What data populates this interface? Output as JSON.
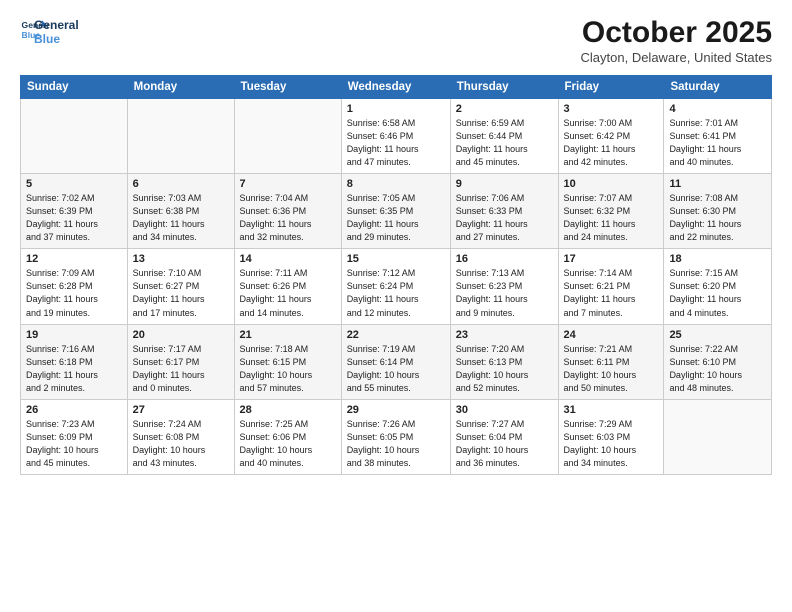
{
  "logo": {
    "line1": "General",
    "line2": "Blue"
  },
  "title": "October 2025",
  "location": "Clayton, Delaware, United States",
  "headers": [
    "Sunday",
    "Monday",
    "Tuesday",
    "Wednesday",
    "Thursday",
    "Friday",
    "Saturday"
  ],
  "weeks": [
    [
      {
        "day": "",
        "info": ""
      },
      {
        "day": "",
        "info": ""
      },
      {
        "day": "",
        "info": ""
      },
      {
        "day": "1",
        "info": "Sunrise: 6:58 AM\nSunset: 6:46 PM\nDaylight: 11 hours\nand 47 minutes."
      },
      {
        "day": "2",
        "info": "Sunrise: 6:59 AM\nSunset: 6:44 PM\nDaylight: 11 hours\nand 45 minutes."
      },
      {
        "day": "3",
        "info": "Sunrise: 7:00 AM\nSunset: 6:42 PM\nDaylight: 11 hours\nand 42 minutes."
      },
      {
        "day": "4",
        "info": "Sunrise: 7:01 AM\nSunset: 6:41 PM\nDaylight: 11 hours\nand 40 minutes."
      }
    ],
    [
      {
        "day": "5",
        "info": "Sunrise: 7:02 AM\nSunset: 6:39 PM\nDaylight: 11 hours\nand 37 minutes."
      },
      {
        "day": "6",
        "info": "Sunrise: 7:03 AM\nSunset: 6:38 PM\nDaylight: 11 hours\nand 34 minutes."
      },
      {
        "day": "7",
        "info": "Sunrise: 7:04 AM\nSunset: 6:36 PM\nDaylight: 11 hours\nand 32 minutes."
      },
      {
        "day": "8",
        "info": "Sunrise: 7:05 AM\nSunset: 6:35 PM\nDaylight: 11 hours\nand 29 minutes."
      },
      {
        "day": "9",
        "info": "Sunrise: 7:06 AM\nSunset: 6:33 PM\nDaylight: 11 hours\nand 27 minutes."
      },
      {
        "day": "10",
        "info": "Sunrise: 7:07 AM\nSunset: 6:32 PM\nDaylight: 11 hours\nand 24 minutes."
      },
      {
        "day": "11",
        "info": "Sunrise: 7:08 AM\nSunset: 6:30 PM\nDaylight: 11 hours\nand 22 minutes."
      }
    ],
    [
      {
        "day": "12",
        "info": "Sunrise: 7:09 AM\nSunset: 6:28 PM\nDaylight: 11 hours\nand 19 minutes."
      },
      {
        "day": "13",
        "info": "Sunrise: 7:10 AM\nSunset: 6:27 PM\nDaylight: 11 hours\nand 17 minutes."
      },
      {
        "day": "14",
        "info": "Sunrise: 7:11 AM\nSunset: 6:26 PM\nDaylight: 11 hours\nand 14 minutes."
      },
      {
        "day": "15",
        "info": "Sunrise: 7:12 AM\nSunset: 6:24 PM\nDaylight: 11 hours\nand 12 minutes."
      },
      {
        "day": "16",
        "info": "Sunrise: 7:13 AM\nSunset: 6:23 PM\nDaylight: 11 hours\nand 9 minutes."
      },
      {
        "day": "17",
        "info": "Sunrise: 7:14 AM\nSunset: 6:21 PM\nDaylight: 11 hours\nand 7 minutes."
      },
      {
        "day": "18",
        "info": "Sunrise: 7:15 AM\nSunset: 6:20 PM\nDaylight: 11 hours\nand 4 minutes."
      }
    ],
    [
      {
        "day": "19",
        "info": "Sunrise: 7:16 AM\nSunset: 6:18 PM\nDaylight: 11 hours\nand 2 minutes."
      },
      {
        "day": "20",
        "info": "Sunrise: 7:17 AM\nSunset: 6:17 PM\nDaylight: 11 hours\nand 0 minutes."
      },
      {
        "day": "21",
        "info": "Sunrise: 7:18 AM\nSunset: 6:15 PM\nDaylight: 10 hours\nand 57 minutes."
      },
      {
        "day": "22",
        "info": "Sunrise: 7:19 AM\nSunset: 6:14 PM\nDaylight: 10 hours\nand 55 minutes."
      },
      {
        "day": "23",
        "info": "Sunrise: 7:20 AM\nSunset: 6:13 PM\nDaylight: 10 hours\nand 52 minutes."
      },
      {
        "day": "24",
        "info": "Sunrise: 7:21 AM\nSunset: 6:11 PM\nDaylight: 10 hours\nand 50 minutes."
      },
      {
        "day": "25",
        "info": "Sunrise: 7:22 AM\nSunset: 6:10 PM\nDaylight: 10 hours\nand 48 minutes."
      }
    ],
    [
      {
        "day": "26",
        "info": "Sunrise: 7:23 AM\nSunset: 6:09 PM\nDaylight: 10 hours\nand 45 minutes."
      },
      {
        "day": "27",
        "info": "Sunrise: 7:24 AM\nSunset: 6:08 PM\nDaylight: 10 hours\nand 43 minutes."
      },
      {
        "day": "28",
        "info": "Sunrise: 7:25 AM\nSunset: 6:06 PM\nDaylight: 10 hours\nand 40 minutes."
      },
      {
        "day": "29",
        "info": "Sunrise: 7:26 AM\nSunset: 6:05 PM\nDaylight: 10 hours\nand 38 minutes."
      },
      {
        "day": "30",
        "info": "Sunrise: 7:27 AM\nSunset: 6:04 PM\nDaylight: 10 hours\nand 36 minutes."
      },
      {
        "day": "31",
        "info": "Sunrise: 7:29 AM\nSunset: 6:03 PM\nDaylight: 10 hours\nand 34 minutes."
      },
      {
        "day": "",
        "info": ""
      }
    ]
  ]
}
